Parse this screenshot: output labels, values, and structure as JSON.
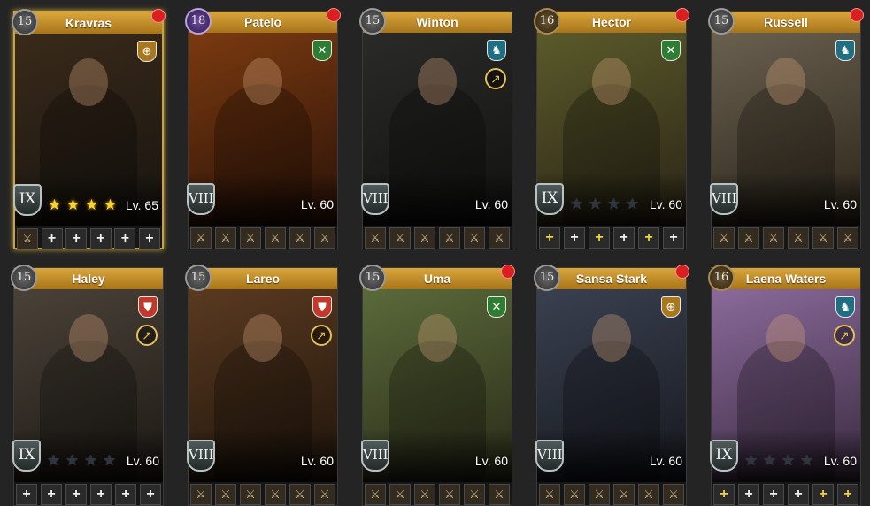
{
  "heroes": [
    {
      "name": "Kravras",
      "rank": "15",
      "badge": "gray",
      "tier": "IX",
      "stars": 4,
      "level": "Lv. 65",
      "class": "gold-outline",
      "class_icon": "bow-icon",
      "class_glyph": "⊕",
      "spear": false,
      "notif": true,
      "selected": true,
      "bg": [
        "#3a2a1a",
        "#171410"
      ],
      "slots": [
        "gear",
        "plus",
        "plus",
        "plus",
        "plus",
        "plus"
      ]
    },
    {
      "name": "Patelo",
      "rank": "18",
      "badge": "purple",
      "tier": "VIII",
      "stars": 0,
      "level": "Lv. 60",
      "class": "green",
      "class_icon": "crossed-spears-icon",
      "class_glyph": "✕",
      "spear": false,
      "notif": true,
      "selected": false,
      "bg": [
        "#7a3a10",
        "#2a1208"
      ],
      "slots": [
        "gear",
        "gear",
        "gear",
        "gear",
        "gear",
        "gear"
      ]
    },
    {
      "name": "Winton",
      "rank": "15",
      "badge": "gray",
      "tier": "VIII",
      "stars": 0,
      "level": "Lv. 60",
      "class": "teal",
      "class_icon": "horse-icon",
      "class_glyph": "♞",
      "spear": true,
      "notif": false,
      "selected": false,
      "bg": [
        "#2a2a28",
        "#111110"
      ],
      "slots": [
        "gear",
        "gear",
        "gear",
        "gear",
        "gear",
        "gear"
      ]
    },
    {
      "name": "Hector",
      "rank": "16",
      "badge": "bronze",
      "tier": "IX",
      "stars": 0,
      "level": "Lv. 60",
      "class": "green",
      "class_icon": "crossed-spears-icon",
      "class_glyph": "✕",
      "spear": false,
      "notif": true,
      "selected": false,
      "bg": [
        "#5a5a2a",
        "#2a2416"
      ],
      "slots": [
        "plus-gold",
        "plus",
        "plus-gold",
        "plus",
        "plus-gold",
        "plus"
      ]
    },
    {
      "name": "Russell",
      "rank": "15",
      "badge": "gray",
      "tier": "VIII",
      "stars": 0,
      "level": "Lv. 60",
      "class": "teal",
      "class_icon": "horse-icon",
      "class_glyph": "♞",
      "spear": false,
      "notif": true,
      "selected": false,
      "bg": [
        "#6a6050",
        "#2a2418"
      ],
      "slots": [
        "gear",
        "gear",
        "gear",
        "gear",
        "gear",
        "gear"
      ]
    },
    {
      "name": "Haley",
      "rank": "15",
      "badge": "gray",
      "tier": "IX",
      "stars": 0,
      "level": "Lv. 60",
      "class": "red",
      "class_icon": "shield-icon",
      "class_glyph": "⛊",
      "spear": true,
      "notif": false,
      "selected": false,
      "bg": [
        "#4a4238",
        "#1c1814"
      ],
      "slots": [
        "plus",
        "plus",
        "plus",
        "plus",
        "plus",
        "plus"
      ]
    },
    {
      "name": "Lareo",
      "rank": "15",
      "badge": "gray",
      "tier": "VIII",
      "stars": 0,
      "level": "Lv. 60",
      "class": "red",
      "class_icon": "shield-icon",
      "class_glyph": "⛊",
      "spear": true,
      "notif": false,
      "selected": false,
      "bg": [
        "#5a3a20",
        "#1e140c"
      ],
      "slots": [
        "gear",
        "gear",
        "gear",
        "gear",
        "gear",
        "gear"
      ]
    },
    {
      "name": "Uma",
      "rank": "15",
      "badge": "gray",
      "tier": "VIII",
      "stars": 0,
      "level": "Lv. 60",
      "class": "green",
      "class_icon": "crossed-spears-icon",
      "class_glyph": "✕",
      "spear": false,
      "notif": true,
      "selected": false,
      "bg": [
        "#5a6a3a",
        "#2a2a18"
      ],
      "slots": [
        "gear",
        "gear",
        "gear",
        "gear",
        "gear",
        "gear"
      ]
    },
    {
      "name": "Sansa Stark",
      "rank": "15",
      "badge": "gray",
      "tier": "VIII",
      "stars": 0,
      "level": "Lv. 60",
      "class": "gold-outline",
      "class_icon": "bow-icon",
      "class_glyph": "⊕",
      "spear": false,
      "notif": true,
      "selected": false,
      "bg": [
        "#3a4050",
        "#16181e"
      ],
      "slots": [
        "gear",
        "gear",
        "gear",
        "gear",
        "gear",
        "gear"
      ]
    },
    {
      "name": "Laena Waters",
      "rank": "16",
      "badge": "bronze",
      "tier": "IX",
      "stars": 0,
      "level": "Lv. 60",
      "class": "teal",
      "class_icon": "horse-icon",
      "class_glyph": "♞",
      "spear": true,
      "notif": false,
      "selected": false,
      "bg": [
        "#8a6a9a",
        "#3a2a40"
      ],
      "slots": [
        "plus-gold",
        "plus",
        "plus",
        "plus",
        "plus-gold",
        "plus-gold"
      ]
    }
  ],
  "ui": {
    "star_glyph": "★",
    "plus_glyph": "+",
    "gear_glyph": "⚔",
    "spear_glyph": "↗",
    "colors": {
      "gold-outline": "#a8781e",
      "green": "#2e7d32",
      "teal": "#1f6e82",
      "red": "#c0392b"
    }
  }
}
